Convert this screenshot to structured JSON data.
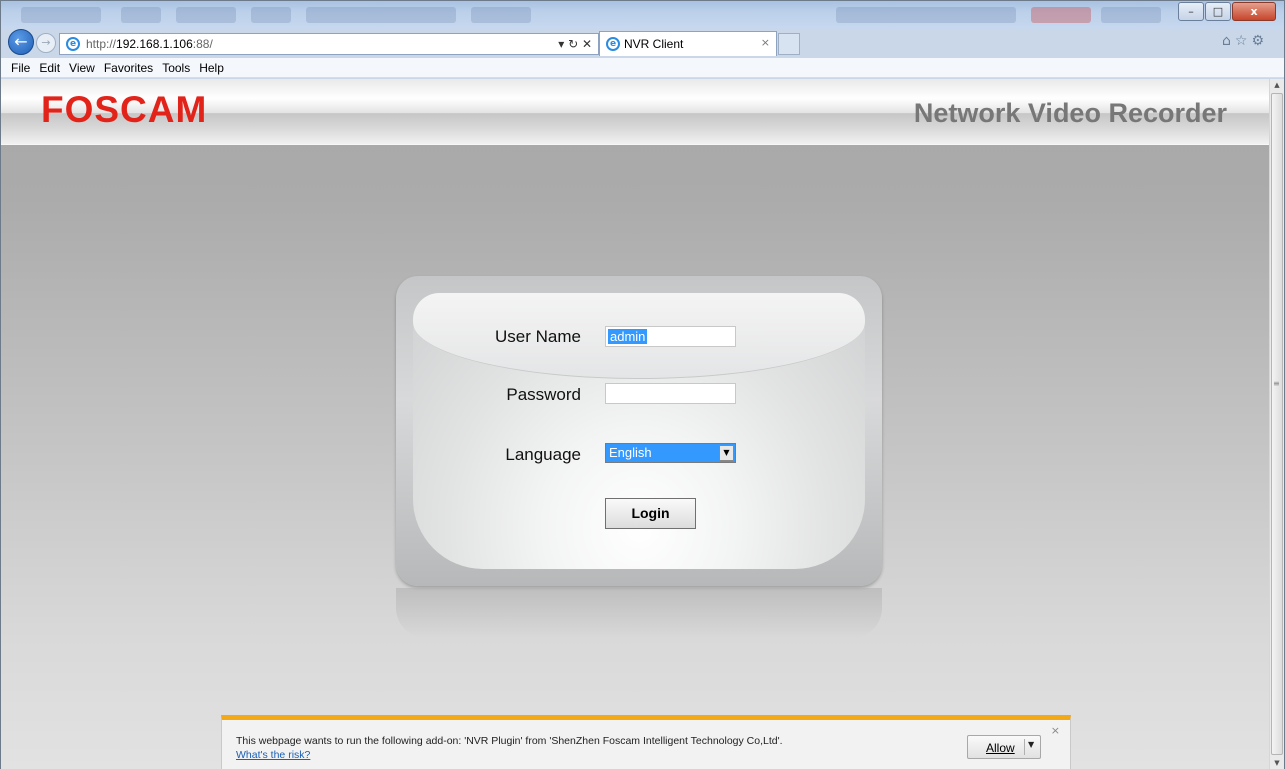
{
  "browser": {
    "url_prefix": "http://",
    "url_host": "192.168.1.106",
    "url_suffix": ":88/",
    "address_controls": "▾ ↻ ✕",
    "tab_title": "NVR Client",
    "tab_close": "×",
    "back_glyph": "←",
    "forward_glyph": "→",
    "right_icons": "⌂☆⚙",
    "window_buttons": {
      "minimize": "–",
      "maximize": "□",
      "close": "x"
    }
  },
  "menu": {
    "items": [
      "File",
      "Edit",
      "View",
      "Favorites",
      "Tools",
      "Help"
    ]
  },
  "header": {
    "logo": "FOSCAM",
    "subtitle": "Network Video Recorder"
  },
  "login": {
    "username_label": "User Name",
    "username_value": "admin",
    "password_label": "Password",
    "password_value": "",
    "language_label": "Language",
    "language_value": "English",
    "login_button": "Login"
  },
  "notification": {
    "message": "This webpage wants to run the following add-on: 'NVR Plugin' from 'ShenZhen Foscam Intelligent Technology Co,Ltd'.",
    "risk_link": "What's the risk?",
    "allow_label": "Allow",
    "close_glyph": "×"
  },
  "colors": {
    "brand_red": "#e2231a",
    "notify_accent": "#f3a816",
    "selection_blue": "#3399ff"
  },
  "icons": {
    "back": "back-arrow-icon",
    "forward": "forward-arrow-icon",
    "ie": "ie-logo-icon",
    "home": "home-icon",
    "favorites": "star-icon",
    "settings": "gear-icon"
  }
}
